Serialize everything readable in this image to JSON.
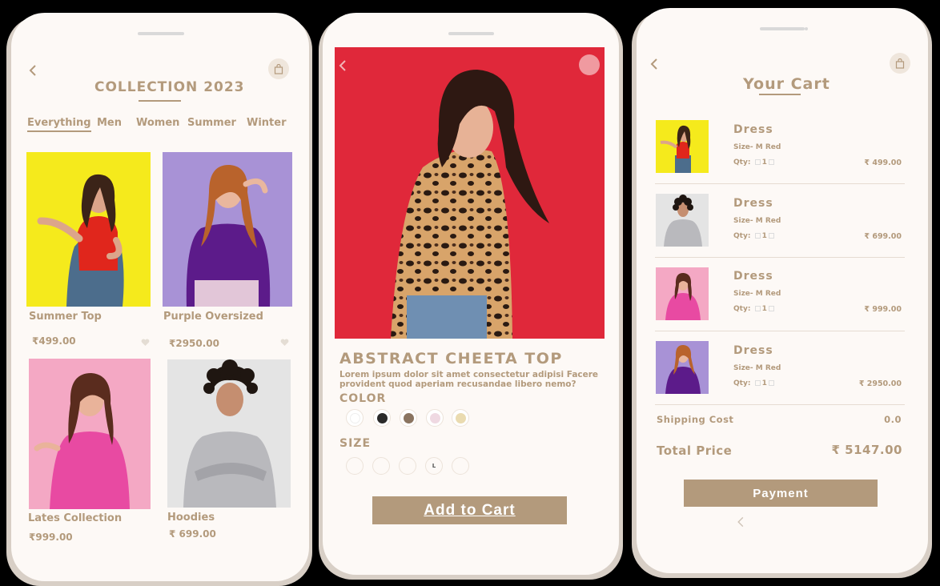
{
  "screen1": {
    "title": "COLLECTION 2023",
    "tabs": [
      "Everything",
      "Men",
      "Women",
      "Summer",
      "Winter"
    ],
    "products": [
      {
        "name": "Summer Top",
        "price": "₹499.00"
      },
      {
        "name": "Purple Oversized",
        "price": "₹2950.00"
      },
      {
        "name": "Lates Collection",
        "price": "₹999.00"
      },
      {
        "name": "Hoodies",
        "price": "₹ 699.00"
      }
    ]
  },
  "screen2": {
    "product_title": "ABSTRACT CHEETA TOP",
    "description": "Lorem ipsum dolor sit amet consectetur adipisi Facere provident quod aperiam recusandae libero nemo?",
    "color_label": "COLOR",
    "size_label": "SIZE",
    "colors": [
      "#ffffff",
      "#2a2a2a",
      "#8a7460",
      "#efd9e2",
      "#eadbb0"
    ],
    "sizes": [
      "",
      "",
      "",
      "L",
      ""
    ],
    "add_to_cart": "Add to Cart"
  },
  "screen3": {
    "title": "Your Cart",
    "items": [
      {
        "name": "Dress",
        "size": "Size- M  Red",
        "qty_label": "Qty:",
        "qty": "1",
        "price": "₹ 499.00"
      },
      {
        "name": "Dress",
        "size": "Size- M  Red",
        "qty_label": "Qty:",
        "qty": "1",
        "price": "₹ 699.00"
      },
      {
        "name": "Dress",
        "size": "Size- M  Red",
        "qty_label": "Qty:",
        "qty": "1",
        "price": "₹ 999.00"
      },
      {
        "name": "Dress",
        "size": "Size- M  Red",
        "qty_label": "Qty:",
        "qty": "1",
        "price": "₹ 2950.00"
      }
    ],
    "shipping_label": "Shipping Cost",
    "shipping_value": "0.0",
    "total_label": "Total Price",
    "total_value": "₹ 5147.00",
    "payment": "Payment"
  },
  "colors": {
    "accent": "#b39a7c",
    "background": "#fdf9f6"
  }
}
